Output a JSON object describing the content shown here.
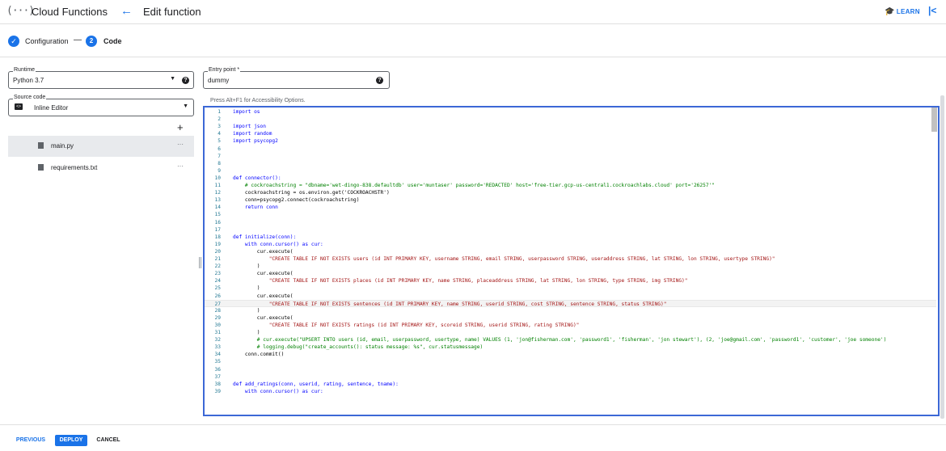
{
  "header": {
    "logo_glyph": "(···)",
    "app_title": "Cloud Functions",
    "back_icon": "arrow-back-icon",
    "page_title": "Edit function",
    "learn_label": "LEARN",
    "collapse_icon": "collapse-panel-icon"
  },
  "stepper": {
    "step1_label": "Configuration",
    "step1_icon": "check-icon",
    "separator": "—",
    "step2_number": "2",
    "step2_label": "Code"
  },
  "runtime": {
    "label": "Runtime",
    "value": "Python 3.7"
  },
  "entry_point": {
    "label": "Entry point *",
    "value": "dummy"
  },
  "source_code": {
    "label": "Source code",
    "value": "Inline Editor"
  },
  "add_file_glyph": "+",
  "files": [
    {
      "name": "main.py",
      "active": true
    },
    {
      "name": "requirements.txt",
      "active": false
    }
  ],
  "editor_hint": "Press Alt+F1 for Accessibility Options.",
  "code": [
    {
      "n": "1",
      "t": "import os"
    },
    {
      "n": "2",
      "t": ""
    },
    {
      "n": "3",
      "t": "import json"
    },
    {
      "n": "4",
      "t": "import random"
    },
    {
      "n": "5",
      "t": "import psycopg2"
    },
    {
      "n": "6",
      "t": ""
    },
    {
      "n": "7",
      "t": ""
    },
    {
      "n": "8",
      "t": ""
    },
    {
      "n": "9",
      "t": ""
    },
    {
      "n": "10",
      "t": "def connector():"
    },
    {
      "n": "11",
      "t": "    # cockroachstring = \"dbname='wet-dingo-838.defaultdb' user='muntaser' password='REDACTED' host='free-tier.gcp-us-central1.cockroachlabs.cloud' port='26257'\""
    },
    {
      "n": "12",
      "t": "    cockroachstring = os.environ.get('COCKROACHSTR')"
    },
    {
      "n": "13",
      "t": "    conn=psycopg2.connect(cockroachstring)"
    },
    {
      "n": "14",
      "t": "    return conn"
    },
    {
      "n": "15",
      "t": ""
    },
    {
      "n": "16",
      "t": ""
    },
    {
      "n": "17",
      "t": ""
    },
    {
      "n": "18",
      "t": "def initialize(conn):"
    },
    {
      "n": "19",
      "t": "    with conn.cursor() as cur:"
    },
    {
      "n": "20",
      "t": "        cur.execute("
    },
    {
      "n": "21",
      "t": "            \"CREATE TABLE IF NOT EXISTS users (id INT PRIMARY KEY, username STRING, email STRING, userpassword STRING, useraddress STRING, lat STRING, lon STRING, usertype STRING)\""
    },
    {
      "n": "22",
      "t": "        )"
    },
    {
      "n": "23",
      "t": "        cur.execute("
    },
    {
      "n": "24",
      "t": "            \"CREATE TABLE IF NOT EXISTS places (id INT PRIMARY KEY, name STRING, placeaddress STRING, lat STRING, lon STRING, type STRING, img STRING)\""
    },
    {
      "n": "25",
      "t": "        )"
    },
    {
      "n": "26",
      "t": "        cur.execute("
    },
    {
      "n": "27",
      "t": "            \"CREATE TABLE IF NOT EXISTS sentences (id INT PRIMARY KEY, name STRING, userid STRING, cost STRING, sentence STRING, status STRING)\""
    },
    {
      "n": "28",
      "t": "        )"
    },
    {
      "n": "29",
      "t": "        cur.execute("
    },
    {
      "n": "30",
      "t": "            \"CREATE TABLE IF NOT EXISTS ratings (id INT PRIMARY KEY, scoreid STRING, userid STRING, rating STRING)\""
    },
    {
      "n": "31",
      "t": "        )"
    },
    {
      "n": "32",
      "t": "        # cur.execute(\"UPSERT INTO users (id, email, userpassword, usertype, name) VALUES (1, 'jon@fisherman.com', 'password1', 'fisherman', 'jon stewart'), (2, 'joe@gmail.com', 'password1', 'customer', 'joe someone')"
    },
    {
      "n": "33",
      "t": "        # logging.debug(\"create_accounts(): status message: %s\", cur.statusmessage)"
    },
    {
      "n": "34",
      "t": "    conn.commit()"
    },
    {
      "n": "35",
      "t": ""
    },
    {
      "n": "36",
      "t": ""
    },
    {
      "n": "37",
      "t": ""
    },
    {
      "n": "38",
      "t": "def add_ratings(conn, userid, rating, sentence, tname):"
    },
    {
      "n": "39",
      "t": "    with conn.cursor() as cur:"
    }
  ],
  "footer": {
    "previous_label": "PREVIOUS",
    "deploy_label": "DEPLOY",
    "cancel_label": "CANCEL"
  }
}
